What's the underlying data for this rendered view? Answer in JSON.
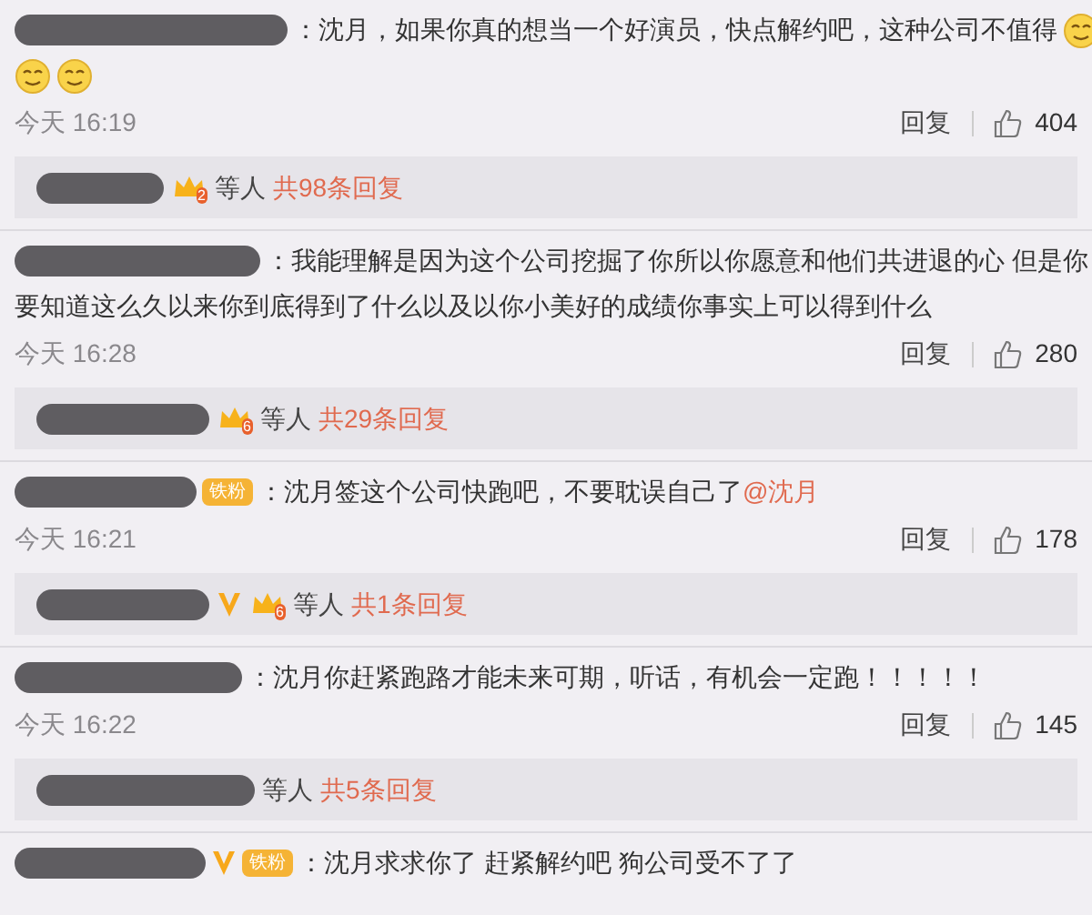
{
  "comments": [
    {
      "lines": [
        [
          {
            "kind": "text",
            "text": "：沈月，如果你真的想当一个好演员，快点解约吧，这种公司不值得"
          },
          {
            "kind": "emoji"
          }
        ],
        [
          {
            "kind": "emoji"
          },
          {
            "kind": "emoji"
          }
        ]
      ],
      "time": "今天 16:19",
      "reply_label": "回复",
      "likes": "404",
      "thread": {
        "badges": [
          {
            "kind": "crown",
            "level": "2"
          }
        ],
        "others": "等人",
        "count": "共98条回复"
      }
    },
    {
      "lines": [
        [
          {
            "kind": "text",
            "text": "：我能理解是因为这个公司挖掘了你所以你愿意和他们共进退的心 但是你"
          }
        ],
        [
          {
            "kind": "text",
            "text": "要知道这么久以来你到底得到了什么以及以你小美好的成绩你事实上可以得到什么"
          }
        ]
      ],
      "time": "今天 16:28",
      "reply_label": "回复",
      "likes": "280",
      "thread": {
        "badges": [
          {
            "kind": "crown",
            "level": "6"
          }
        ],
        "others": "等人",
        "count": "共29条回复"
      }
    },
    {
      "badges": [
        {
          "kind": "fan",
          "label": "铁粉"
        }
      ],
      "lines": [
        [
          {
            "kind": "text",
            "text": "：沈月签这个公司快跑吧，不要耽误自己了"
          },
          {
            "kind": "mention",
            "text": "@沈月"
          }
        ]
      ],
      "time": "今天 16:21",
      "reply_label": "回复",
      "likes": "178",
      "thread": {
        "badges": [
          {
            "kind": "vip"
          },
          {
            "kind": "crown",
            "level": "6"
          }
        ],
        "others": "等人",
        "count": "共1条回复"
      }
    },
    {
      "lines": [
        [
          {
            "kind": "text",
            "text": "：沈月你赶紧跑路才能未来可期，听话，有机会一定跑！！！！！"
          }
        ]
      ],
      "time": "今天 16:22",
      "reply_label": "回复",
      "likes": "145",
      "thread": {
        "others": "等人",
        "count": "共5条回复"
      }
    },
    {
      "badges": [
        {
          "kind": "vip"
        },
        {
          "kind": "fan",
          "label": "铁粉"
        }
      ],
      "lines": [
        [
          {
            "kind": "text",
            "text": "：沈月求求你了 赶紧解约吧  狗公司受不了了"
          }
        ]
      ]
    }
  ]
}
